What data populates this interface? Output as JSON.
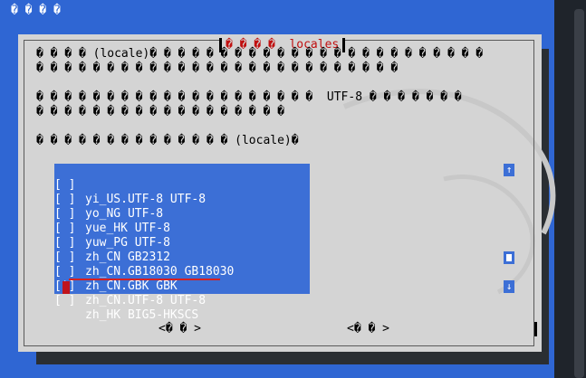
{
  "window": {
    "title": "� � � �"
  },
  "dialog": {
    "title_prefix": "� � � �",
    "title": "locales",
    "intro": {
      "line1": "� � � � (locale)� � � � � � � � � � � � � � � � � � � � � � � �",
      "line2": "� � � � � � � � � � � � � � � � � � � � � � � � � �",
      "line3": "� � � � � � � � � � � � � � � � � � � �  UTF-8 � � � � � � �",
      "line4": "� � � � � � � � � � � � � � � � � �",
      "line5": "� � � � � � � � � � � � � � (locale)�"
    },
    "locales": [
      {
        "check": "[ ]",
        "name": "yi_US.UTF-8 UTF-8"
      },
      {
        "check": "[ ]",
        "name": "yo_NG UTF-8"
      },
      {
        "check": "[ ]",
        "name": "yue_HK UTF-8"
      },
      {
        "check": "[ ]",
        "name": "yuw_PG UTF-8"
      },
      {
        "check": "[ ]",
        "name": "zh_CN GB2312"
      },
      {
        "check": "[ ]",
        "name": "zh_CN.GB18030 GB18030"
      },
      {
        "check": "[ ]",
        "name": "zh_CN.GBK GBK"
      },
      {
        "check": "[*]",
        "name": "zh_CN.UTF-8 UTF-8"
      },
      {
        "check": "[ ]",
        "name": "zh_HK BIG5-HKSCS"
      }
    ],
    "scroll": {
      "up": "↑",
      "down": "↓"
    },
    "buttons": {
      "ok": "<� � >",
      "cancel": "<� � >"
    }
  },
  "colors": {
    "list_bg": "#3c6fd6",
    "dialog_bg": "#d4d4d4",
    "title_red": "#c01010",
    "highlight_red": "#d62020"
  }
}
